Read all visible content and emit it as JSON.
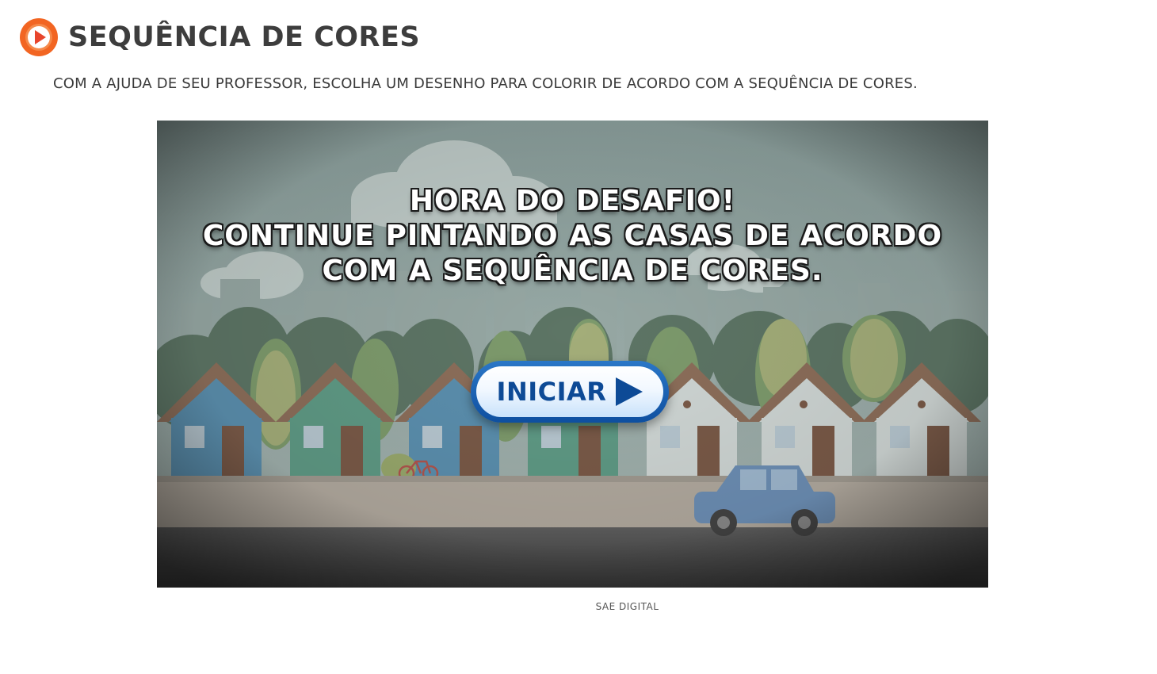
{
  "header": {
    "title": "SEQUÊNCIA DE CORES",
    "icon": "play-circle-icon",
    "accent_color": "#f26522"
  },
  "instructions": "COM A AJUDA DE SEU PROFESSOR, ESCOLHA UM DESENHO PARA COLORIR DE ACORDO COM A SEQUÊNCIA DE CORES.",
  "game": {
    "lines": [
      "HORA DO DESAFIO!",
      "CONTINUE PINTANDO AS CASAS DE ACORDO",
      "COM A SEQUÊNCIA DE CORES."
    ],
    "start_button_label": "INICIAR",
    "start_button_icon": "play-arrow-icon",
    "button_color": "#0d4a96"
  },
  "caption": "SAE DIGITAL"
}
